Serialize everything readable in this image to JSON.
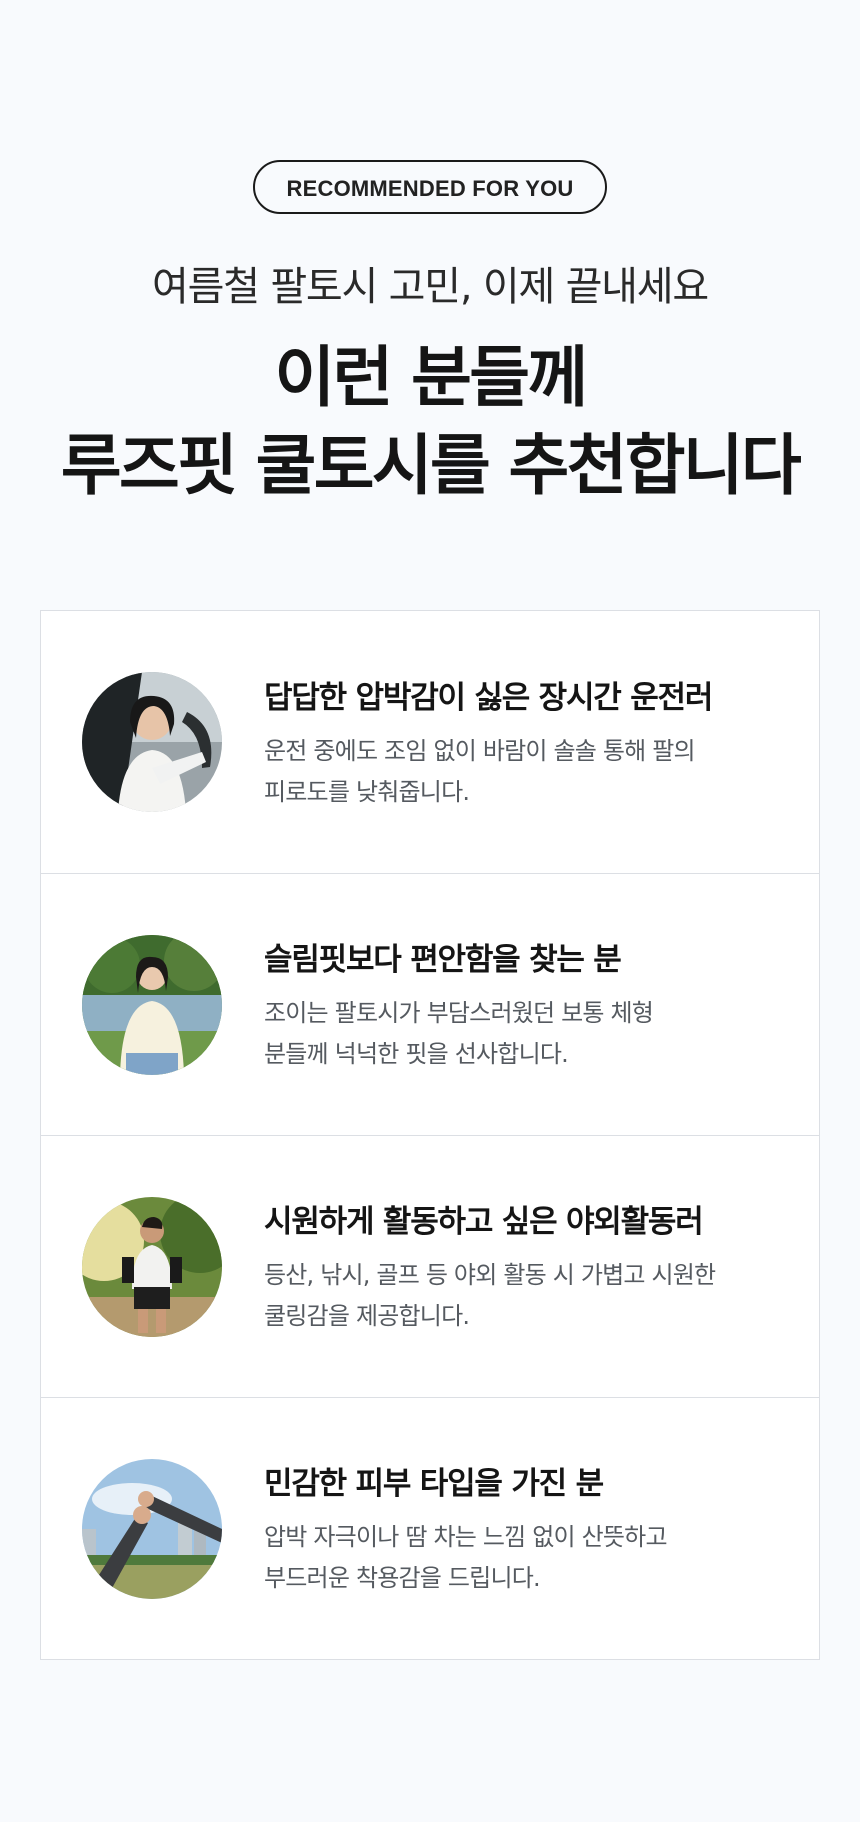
{
  "hero": {
    "badge": "RECOMMENDED FOR YOU",
    "subtitle": "여름철 팔토시 고민, 이제 끝내세요",
    "headline_line1": "이런 분들께",
    "headline_line2": "루즈핏 쿨토시를 추천합니다"
  },
  "cards": [
    {
      "title": "답답한 압박감이 싫은 장시간 운전러",
      "desc_line1": "운전 중에도 조임 없이 바람이 솔솔 통해 팔의",
      "desc_line2": "피로도를 낮춰줍니다.",
      "image": "woman-driving-car-photo"
    },
    {
      "title": "슬림핏보다 편안함을 찾는 분",
      "desc_line1": "조이는 팔토시가 부담스러웠던 보통 체형",
      "desc_line2": "분들께 넉넉한 핏을 선사합니다.",
      "image": "woman-by-lake-photo"
    },
    {
      "title": "시원하게 활동하고 싶은 야외활동러",
      "desc_line1": "등산, 낚시, 골프 등 야외 활동 시 가볍고 시원한",
      "desc_line2": "쿨링감을 제공합니다.",
      "image": "man-running-park-photo"
    },
    {
      "title": "민감한 피부 타입을 가진 분",
      "desc_line1": "압박 자극이나 땀 차는 느낌 없이 산뜻하고",
      "desc_line2": "부드러운 착용감을 드립니다.",
      "image": "arms-sleeves-sky-photo"
    }
  ]
}
